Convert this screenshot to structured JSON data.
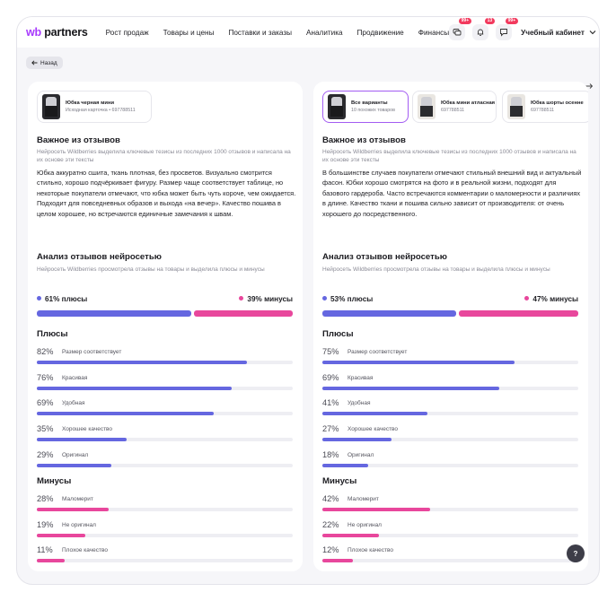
{
  "header": {
    "logo_prefix": "wb",
    "logo_suffix": " partners",
    "nav": [
      "Рост продаж",
      "Товары и цены",
      "Поставки и заказы",
      "Аналитика",
      "Продвижение",
      "Финансы"
    ],
    "badges": [
      "99+",
      "13",
      "99+"
    ],
    "cabinet_label": "Учебный кабинет"
  },
  "back_label": "Назад",
  "help_label": "?",
  "colors": {
    "accent_purple": "#a73afd",
    "plus": "#6567e0",
    "minus": "#e8479c",
    "track": "#eeeef3"
  },
  "left": {
    "card": {
      "name": "Юбка черная мини",
      "sub": "Исходная карточка • 697788511"
    },
    "reviews_title": "Важное из отзывов",
    "reviews_note": "Нейросеть Wildberries выделила ключевые тезисы из последних 1000 отзывов и написала на их основе эти тексты",
    "reviews_text": "Юбка аккуратно сшита, ткань плотная, без просветов. Визуально смотрится стильно, хорошо подчёркивает фигуру. Размер чаще соответствует таблице, но некоторые покупатели отмечают, что юбка может быть чуть короче, чем ожидается. Подходит для повседневных образов и выхода «на вечер». Качество пошива в целом хорошее, но встречаются единичные замечания к швам.",
    "analysis_title": "Анализ отзывов нейросетью",
    "analysis_note": "Нейросеть Wildberries просмотрела отзывы на товары и выделила плюсы и минусы",
    "plus_pct": 61,
    "plus_label": "61% плюсы",
    "minus_pct": 39,
    "minus_label": "39% минусы",
    "plus_title": "Плюсы",
    "pluses": [
      {
        "pct": "82%",
        "value": 82,
        "label": "Размер соответствует"
      },
      {
        "pct": "76%",
        "value": 76,
        "label": "Красивая"
      },
      {
        "pct": "69%",
        "value": 69,
        "label": "Удобная"
      },
      {
        "pct": "35%",
        "value": 35,
        "label": "Хорошее качество"
      },
      {
        "pct": "29%",
        "value": 29,
        "label": "Оригинал"
      }
    ],
    "minus_title": "Минусы",
    "minuses": [
      {
        "pct": "28%",
        "value": 28,
        "label": "Маломерит"
      },
      {
        "pct": "19%",
        "value": 19,
        "label": "Не оригинал"
      },
      {
        "pct": "11%",
        "value": 11,
        "label": "Плохое качество"
      }
    ]
  },
  "right": {
    "cards": [
      {
        "name": "Все варианты",
        "sub": "10 похожих товаров",
        "active": true
      },
      {
        "name": "Юбка мини атласная",
        "sub": "697788511",
        "active": false
      },
      {
        "name": "Юбка шорты осенне",
        "sub": "697788511",
        "active": false
      }
    ],
    "reviews_title": "Важное из отзывов",
    "reviews_note": "Нейросеть Wildberries выделила ключевые тезисы из последних 1000 отзывов и написала на их основе эти тексты",
    "reviews_text": "В большинстве случаев покупатели отмечают стильный внешний вид и актуальный фасон. Юбки хорошо смотрятся на фото и в реальной жизни, подходят для базового гардероба. Часто встречаются комментарии о маломерности и различиях в длине. Качество ткани и пошива сильно зависит от производителя: от очень хорошего до посредственного.",
    "analysis_title": "Анализ отзывов нейросетью",
    "analysis_note": "Нейросеть Wildberries просмотрела отзывы на товары и выделила плюсы и минусы",
    "plus_pct": 53,
    "plus_label": "53% плюсы",
    "minus_pct": 47,
    "minus_label": "47% минусы",
    "plus_title": "Плюсы",
    "pluses": [
      {
        "pct": "75%",
        "value": 75,
        "label": "Размер соответствует"
      },
      {
        "pct": "69%",
        "value": 69,
        "label": "Красивая"
      },
      {
        "pct": "41%",
        "value": 41,
        "label": "Удобная"
      },
      {
        "pct": "27%",
        "value": 27,
        "label": "Хорошее качество"
      },
      {
        "pct": "18%",
        "value": 18,
        "label": "Оригинал"
      }
    ],
    "minus_title": "Минусы",
    "minuses": [
      {
        "pct": "42%",
        "value": 42,
        "label": "Маломерит"
      },
      {
        "pct": "22%",
        "value": 22,
        "label": "Не оригинал"
      },
      {
        "pct": "12%",
        "value": 12,
        "label": "Плохое качество"
      }
    ]
  }
}
